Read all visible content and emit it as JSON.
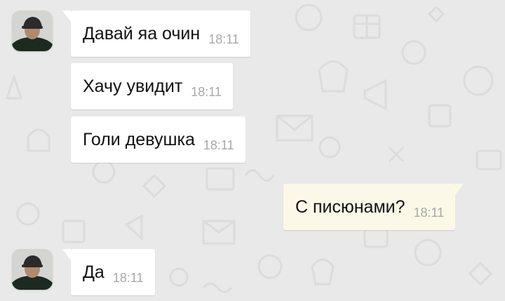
{
  "chat": {
    "messages": [
      {
        "text": "Давай яа очин",
        "time": "18:11",
        "direction": "incoming"
      },
      {
        "text": "Хачу увидит",
        "time": "18:11",
        "direction": "incoming"
      },
      {
        "text": "Голи девушка",
        "time": "18:11",
        "direction": "incoming"
      },
      {
        "text": "С писюнами?",
        "time": "18:11",
        "direction": "outgoing"
      },
      {
        "text": "Да",
        "time": "18:11",
        "direction": "incoming"
      }
    ]
  },
  "colors": {
    "background": "#e9e9e9",
    "incoming_bubble": "#ffffff",
    "outgoing_bubble": "#fcf8e8",
    "time_text": "#a8a8a8"
  }
}
